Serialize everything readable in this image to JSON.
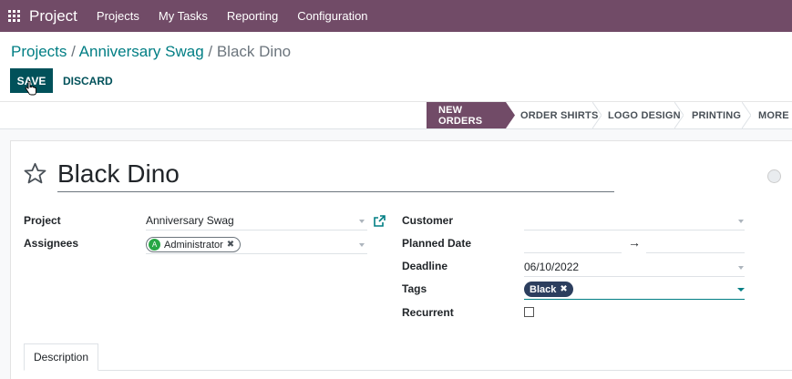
{
  "navbar": {
    "brand": "Project",
    "menu": [
      "Projects",
      "My Tasks",
      "Reporting",
      "Configuration"
    ]
  },
  "breadcrumb": {
    "items": [
      "Projects",
      "Anniversary Swag"
    ],
    "separator": " / ",
    "current": "Black Dino"
  },
  "actions": {
    "save": "SAVE",
    "discard": "DISCARD"
  },
  "stages": [
    "NEW ORDERS",
    "ORDER SHIRTS",
    "LOGO DESIGN",
    "PRINTING",
    "MORE"
  ],
  "task": {
    "title": "Black Dino",
    "project_label": "Project",
    "project_value": "Anniversary Swag",
    "assignees_label": "Assignees",
    "assignee": {
      "initial": "A",
      "name": "Administrator"
    },
    "customer_label": "Customer",
    "customer_value": "",
    "planned_date_label": "Planned Date",
    "planned_arrow": "→",
    "deadline_label": "Deadline",
    "deadline_value": "06/10/2022",
    "tags_label": "Tags",
    "tag": "Black",
    "recurrent_label": "Recurrent"
  },
  "tabs": [
    "Description"
  ],
  "colors": {
    "navbar": "#714b67",
    "primary": "#01515a",
    "link": "#017e84",
    "tag_black": "#2c3e5e"
  }
}
